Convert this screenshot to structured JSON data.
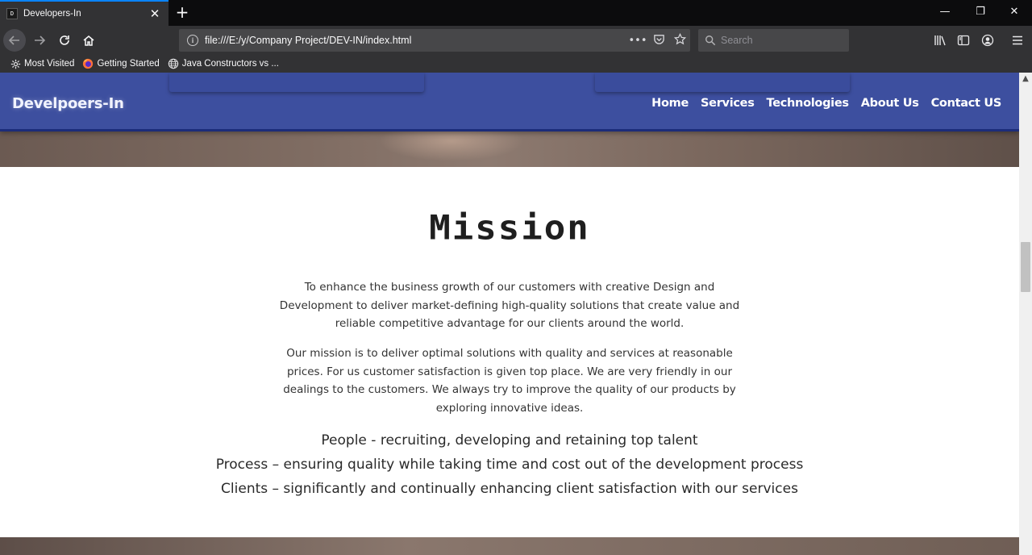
{
  "browser": {
    "tab": {
      "favicon_text": "D",
      "title": "Developers-In",
      "close": "✕"
    },
    "new_tab": "+",
    "window_controls": {
      "minimize": "—",
      "restore": "❐",
      "close": "✕"
    },
    "url": "file:///E:/y/Company Project/DEV-IN/index.html",
    "page_actions": "•••",
    "search_placeholder": "Search",
    "bookmarks": [
      {
        "label": "Most Visited",
        "icon": "gear-icon"
      },
      {
        "label": "Getting Started",
        "icon": "firefox-icon"
      },
      {
        "label": "Java Constructors vs ...",
        "icon": "globe-icon"
      }
    ]
  },
  "site": {
    "brand": "Develpoers-In",
    "nav": [
      {
        "label": "Home"
      },
      {
        "label": "Services"
      },
      {
        "label": "Technologies"
      },
      {
        "label": "About Us"
      },
      {
        "label": "Contact US"
      }
    ],
    "accent_color": "#3d4f9f"
  },
  "mission": {
    "title": "Mission",
    "paragraph1": "To enhance the business growth of our customers with creative Design and Development to deliver market-defining high-quality solutions that create value and reliable competitive advantage for our clients around the world.",
    "paragraph2": "Our mission is to deliver optimal solutions with quality and services at reasonable prices. For us customer satisfaction is given top place. We are very friendly in our dealings to the customers. We always try to improve the quality of our products by exploring innovative ideas.",
    "points": [
      "People - recruiting, developing and retaining top talent",
      "Process – ensuring quality while taking time and cost out of the development process",
      "Clients – significantly and continually enhancing client satisfaction with our services"
    ]
  }
}
